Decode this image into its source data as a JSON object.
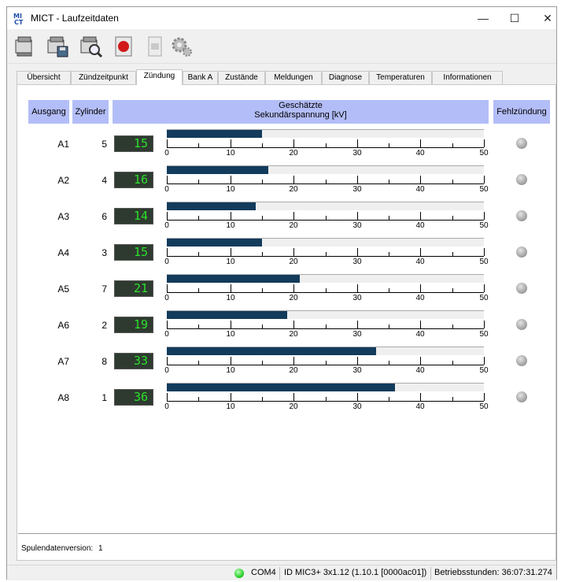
{
  "window": {
    "title": "MICT - Laufzeitdaten",
    "minimize_label": "—",
    "maximize_label": "☐",
    "close_label": "✕"
  },
  "toolbar": {
    "icons": [
      "computer-read-icon",
      "computer-save-icon",
      "computer-search-icon",
      "record-icon",
      "document-icon",
      "settings-gear-icon"
    ]
  },
  "tabs": [
    {
      "label": "Übersicht",
      "active": false
    },
    {
      "label": "Zündzeitpunkt",
      "active": false
    },
    {
      "label": "Zündung",
      "active": true
    },
    {
      "label": "Bank A",
      "active": false
    },
    {
      "label": "Zustände",
      "active": false
    },
    {
      "label": "Meldungen",
      "active": false
    },
    {
      "label": "Diagnose",
      "active": false
    },
    {
      "label": "Temperaturen",
      "active": false
    },
    {
      "label": "Informationen",
      "active": false
    }
  ],
  "table": {
    "headers": {
      "ausgang": "Ausgang",
      "zylinder": "Zylinder",
      "voltage_line1": "Geschätzte",
      "voltage_line2": "Sekundärspannung [kV]",
      "misfire": "Fehlzündung"
    },
    "scale": {
      "min": 0,
      "max": 50,
      "labels": [
        "0",
        "10",
        "20",
        "30",
        "40",
        "50"
      ]
    },
    "rows": [
      {
        "ausgang": "A1",
        "zylinder": "5",
        "display": "15",
        "value": 15
      },
      {
        "ausgang": "A2",
        "zylinder": "4",
        "display": "16",
        "value": 16
      },
      {
        "ausgang": "A3",
        "zylinder": "6",
        "display": "14",
        "value": 14
      },
      {
        "ausgang": "A4",
        "zylinder": "3",
        "display": "15",
        "value": 15
      },
      {
        "ausgang": "A5",
        "zylinder": "7",
        "display": "21",
        "value": 21
      },
      {
        "ausgang": "A6",
        "zylinder": "2",
        "display": "19",
        "value": 19
      },
      {
        "ausgang": "A7",
        "zylinder": "8",
        "display": "33",
        "value": 33
      },
      {
        "ausgang": "A8",
        "zylinder": "1",
        "display": "36",
        "value": 36
      }
    ]
  },
  "footer": {
    "coil_data_label": "Spulendatenversion:",
    "coil_data_value": "1"
  },
  "statusbar": {
    "port": "COM4",
    "device_id": "ID MIC3+ 3x1.12 (1.10.1 [0000ac01])",
    "hours": "Betriebsstunden: 36:07:31.274",
    "connection_color": "#22cc22"
  }
}
